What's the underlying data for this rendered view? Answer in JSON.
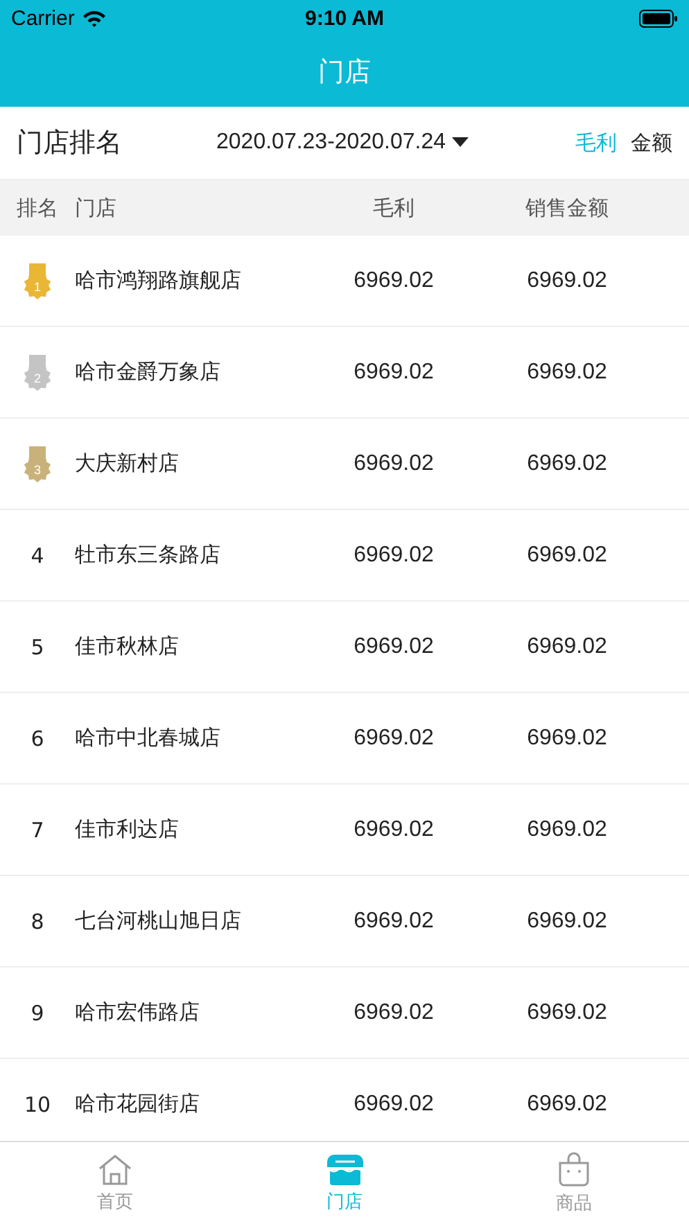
{
  "status_bar": {
    "carrier": "Carrier",
    "time": "9:10 AM"
  },
  "header": {
    "title": "门店"
  },
  "filter": {
    "title": "门店排名",
    "date_range": "2020.07.23-2020.07.24",
    "toggles": [
      {
        "label": "毛利",
        "selected": true
      },
      {
        "label": "金额",
        "selected": false
      }
    ]
  },
  "table": {
    "columns": [
      "排名",
      "门店",
      "毛利",
      "销售金额"
    ],
    "rows": [
      {
        "rank": "1",
        "kind": "medal",
        "color": "#e9b636",
        "store": "哈市鸿翔路旗舰店",
        "profit": "6969.02",
        "sales": "6969.02"
      },
      {
        "rank": "2",
        "kind": "medal",
        "color": "#c4c4c4",
        "store": "哈市金爵万象店",
        "profit": "6969.02",
        "sales": "6969.02"
      },
      {
        "rank": "3",
        "kind": "medal",
        "color": "#c9b27a",
        "store": "大庆新村店",
        "profit": "6969.02",
        "sales": "6969.02"
      },
      {
        "rank": "4",
        "kind": "plain",
        "store": "牡市东三条路店",
        "profit": "6969.02",
        "sales": "6969.02"
      },
      {
        "rank": "5",
        "kind": "plain",
        "store": "佳市秋林店",
        "profit": "6969.02",
        "sales": "6969.02"
      },
      {
        "rank": "6",
        "kind": "plain",
        "store": "哈市中北春城店",
        "profit": "6969.02",
        "sales": "6969.02"
      },
      {
        "rank": "7",
        "kind": "plain",
        "store": "佳市利达店",
        "profit": "6969.02",
        "sales": "6969.02"
      },
      {
        "rank": "8",
        "kind": "plain",
        "store": "七台河桃山旭日店",
        "profit": "6969.02",
        "sales": "6969.02"
      },
      {
        "rank": "9",
        "kind": "plain",
        "store": "哈市宏伟路店",
        "profit": "6969.02",
        "sales": "6969.02"
      },
      {
        "rank": "10",
        "kind": "plain",
        "store": "哈市花园街店",
        "profit": "6969.02",
        "sales": "6969.02"
      }
    ]
  },
  "tab_bar": [
    {
      "label": "首页",
      "kind": "home",
      "selected": false
    },
    {
      "label": "门店",
      "kind": "store",
      "selected": true
    },
    {
      "label": "商品",
      "kind": "bag",
      "selected": false
    }
  ]
}
